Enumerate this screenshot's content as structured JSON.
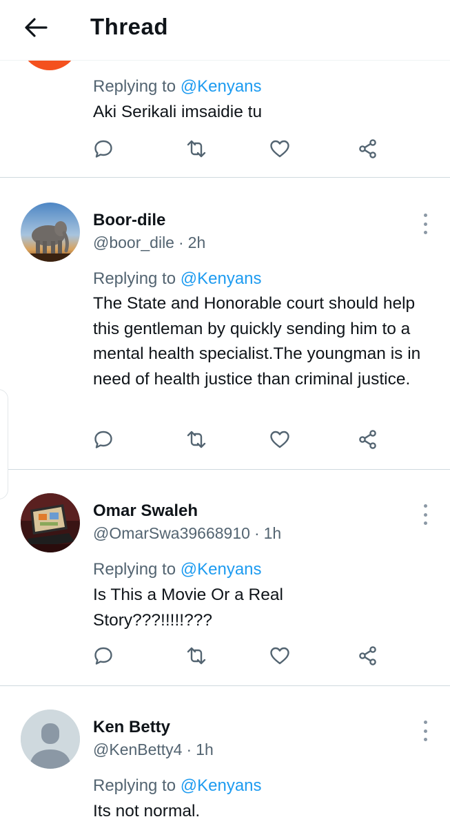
{
  "header": {
    "title": "Thread"
  },
  "tweets": [
    {
      "replying_prefix": "Replying to",
      "replying_handle": "@Kenyans",
      "text": "Aki Serikali imsaidie tu"
    },
    {
      "name": "Boor-dile",
      "handle": "@boor_dile",
      "time": "2h",
      "replying_prefix": "Replying to",
      "replying_handle": "@Kenyans",
      "text": "The State and Honorable court should help this gentleman by quickly sending him to a mental health specialist.The youngman is in need of health justice than criminal justice.",
      "avatar": "elephant-photo"
    },
    {
      "name": "Omar Swaleh",
      "handle": "@OmarSwa39668910",
      "time": "1h",
      "replying_prefix": "Replying to",
      "replying_handle": "@Kenyans",
      "text": "Is This a Movie Or a Real Story???!!!!!???",
      "avatar": "laptop-photo"
    },
    {
      "name": "Ken Betty",
      "handle": "@KenBetty4",
      "time": "1h",
      "replying_prefix": "Replying to",
      "replying_handle": "@Kenyans",
      "text": "Its not normal.",
      "avatar": "default-profile"
    }
  ],
  "dot_separator": "·",
  "icons": {
    "back": "arrow-left-icon",
    "reply": "reply-bubble-icon",
    "retweet": "retweet-icon",
    "like": "heart-icon",
    "share": "share-icon",
    "more": "more-vertical-icon"
  },
  "colors": {
    "link": "#1d9bf0",
    "muted": "#536471",
    "text": "#0f1419",
    "partial_avatar": "#f4511e"
  }
}
